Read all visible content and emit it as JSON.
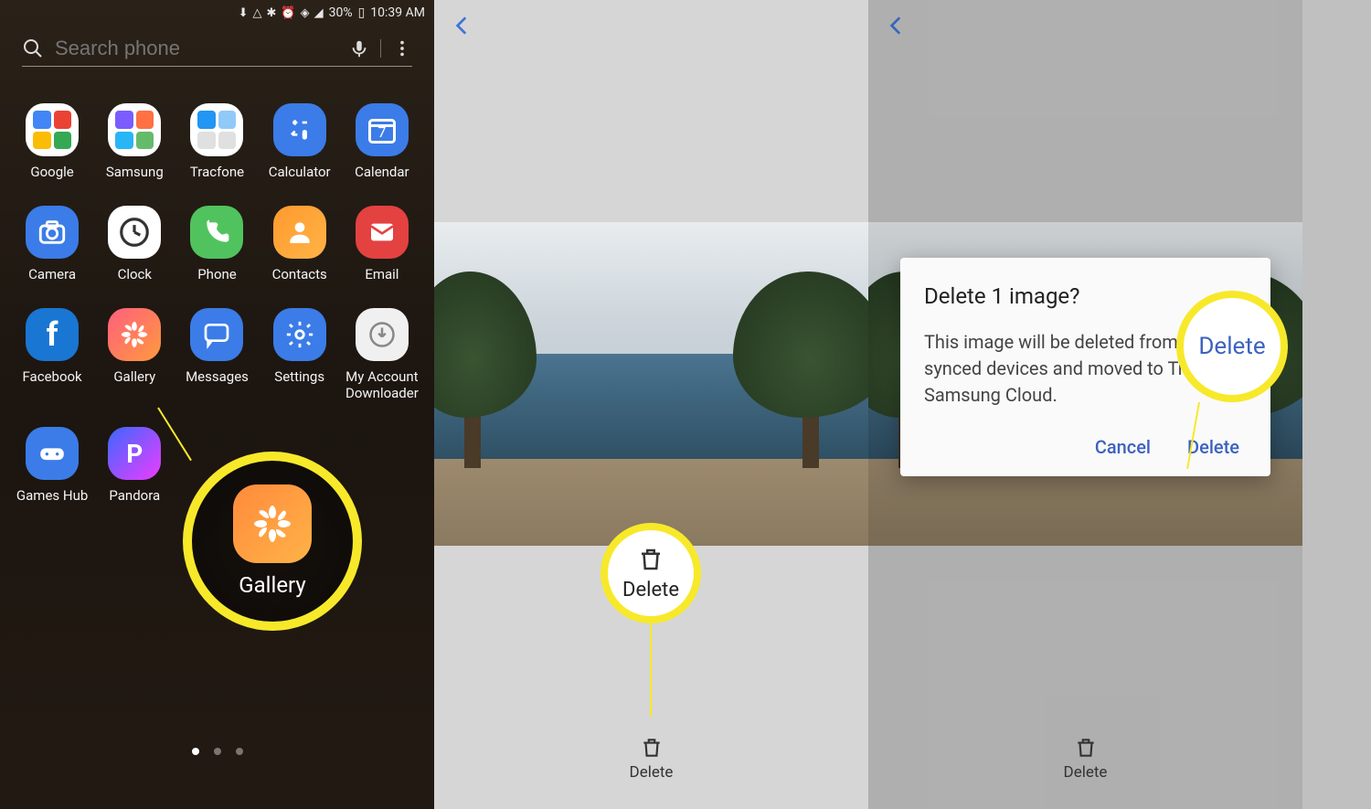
{
  "statusBar": {
    "battery": "30%",
    "time": "10:39 AM"
  },
  "search": {
    "placeholder": "Search phone"
  },
  "apps": {
    "row1": [
      "Google",
      "Samsung",
      "Tracfone",
      "Calculator",
      "Calendar"
    ],
    "row2": [
      "Camera",
      "Clock",
      "Phone",
      "Contacts",
      "Email"
    ],
    "row3": [
      "Facebook",
      "Gallery",
      "Messages",
      "Settings",
      "My Account Downloader"
    ],
    "row4": [
      "Games Hub",
      "Pandora"
    ]
  },
  "callouts": {
    "gallery": "Gallery",
    "delete": "Delete",
    "deleteDialog": "Delete"
  },
  "viewer": {
    "deleteLabel": "Delete"
  },
  "dialog": {
    "title": "Delete 1 image?",
    "body": "This image will be deleted from your synced devices and moved to Trash in Samsung Cloud.",
    "cancel": "Cancel",
    "delete": "Delete"
  }
}
